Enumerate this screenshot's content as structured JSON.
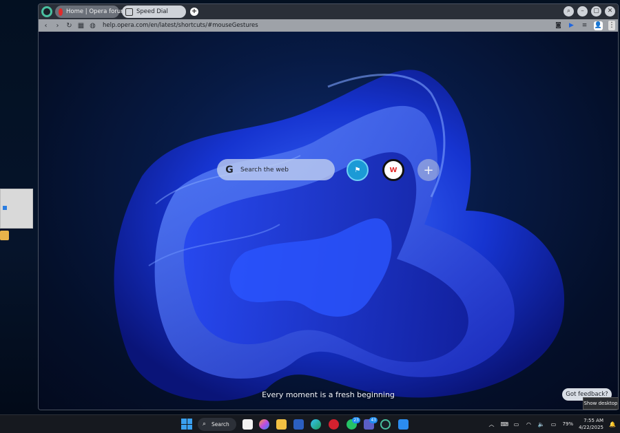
{
  "tabs": [
    {
      "label": "Home | Opera forums",
      "active": false
    },
    {
      "label": "Speed Dial",
      "active": true
    }
  ],
  "address_bar": {
    "url": "help.opera.com/en/latest/shortcuts/#mouseGestures"
  },
  "speed_dial": {
    "search_placeholder": "Search the web",
    "tagline": "Every moment is a fresh beginning",
    "dials": [
      {
        "name": "forums-dial",
        "glyph": "⚑"
      },
      {
        "name": "w-dial",
        "glyph": "W"
      },
      {
        "name": "add-dial",
        "glyph": "+"
      }
    ],
    "feedback_label": "Got feedback?"
  },
  "tooltip": {
    "show_desktop": "Show desktop"
  },
  "taskbar": {
    "search_label": "Search",
    "badges": {
      "whatsapp": "23",
      "teams": "43"
    },
    "battery": "79%",
    "time": "7:55 AM",
    "date": "4/22/2025"
  },
  "colors": {
    "accent": "#1b9ad6",
    "wallpaper_blue": "#1f4dff",
    "opera_red": "#e22a2a"
  }
}
